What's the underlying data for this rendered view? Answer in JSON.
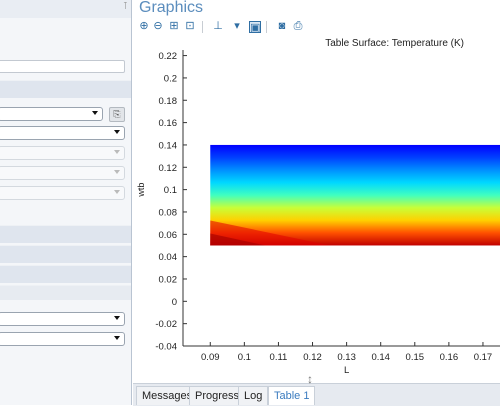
{
  "graphics": {
    "title": "Graphics",
    "toolbar": [
      {
        "icon": "zoom-in-icon",
        "glyph": "⊕"
      },
      {
        "icon": "zoom-out-icon",
        "glyph": "⊖"
      },
      {
        "icon": "zoom-box-icon",
        "glyph": "⊞"
      },
      {
        "icon": "zoom-extents-icon",
        "glyph": "⊡"
      },
      {
        "icon": "axis-orientation-icon",
        "glyph": "⊥"
      },
      {
        "icon": "dropdown-arrow-icon",
        "glyph": "▾"
      },
      {
        "icon": "window-view-icon",
        "glyph": "▣"
      },
      {
        "icon": "camera-icon",
        "glyph": "◙"
      },
      {
        "icon": "print-icon",
        "glyph": "⎙"
      }
    ]
  },
  "chart_data": {
    "type": "heatmap",
    "title": "Table Surface: Temperature (K)",
    "xlabel": "L",
    "ylabel": "wtb",
    "xlim": [
      0.082,
      0.175
    ],
    "ylim": [
      -0.04,
      0.225
    ],
    "x_ticks": [
      "0.09",
      "0.1",
      "0.11",
      "0.12",
      "0.13",
      "0.14",
      "0.15",
      "0.16",
      "0.17"
    ],
    "y_ticks": [
      "0.22",
      "0.2",
      "0.18",
      "0.16",
      "0.14",
      "0.12",
      "0.1",
      "0.08",
      "0.06",
      "0.04",
      "0.02",
      "0",
      "-0.02",
      "-0.04"
    ],
    "surface": {
      "x_range": [
        0.09,
        0.175
      ],
      "y_range": [
        0.05,
        0.14
      ],
      "colormap": [
        "#00007f",
        "#0000ff",
        "#0080ff",
        "#00ffff",
        "#80ff80",
        "#ffff00",
        "#ff8000",
        "#ff0000",
        "#7f0000"
      ]
    }
  },
  "tabs": [
    {
      "label": "Messages",
      "active": false
    },
    {
      "label": "Progress",
      "active": false
    },
    {
      "label": "Log",
      "active": false
    },
    {
      "label": "Table 1",
      "active": true
    }
  ]
}
